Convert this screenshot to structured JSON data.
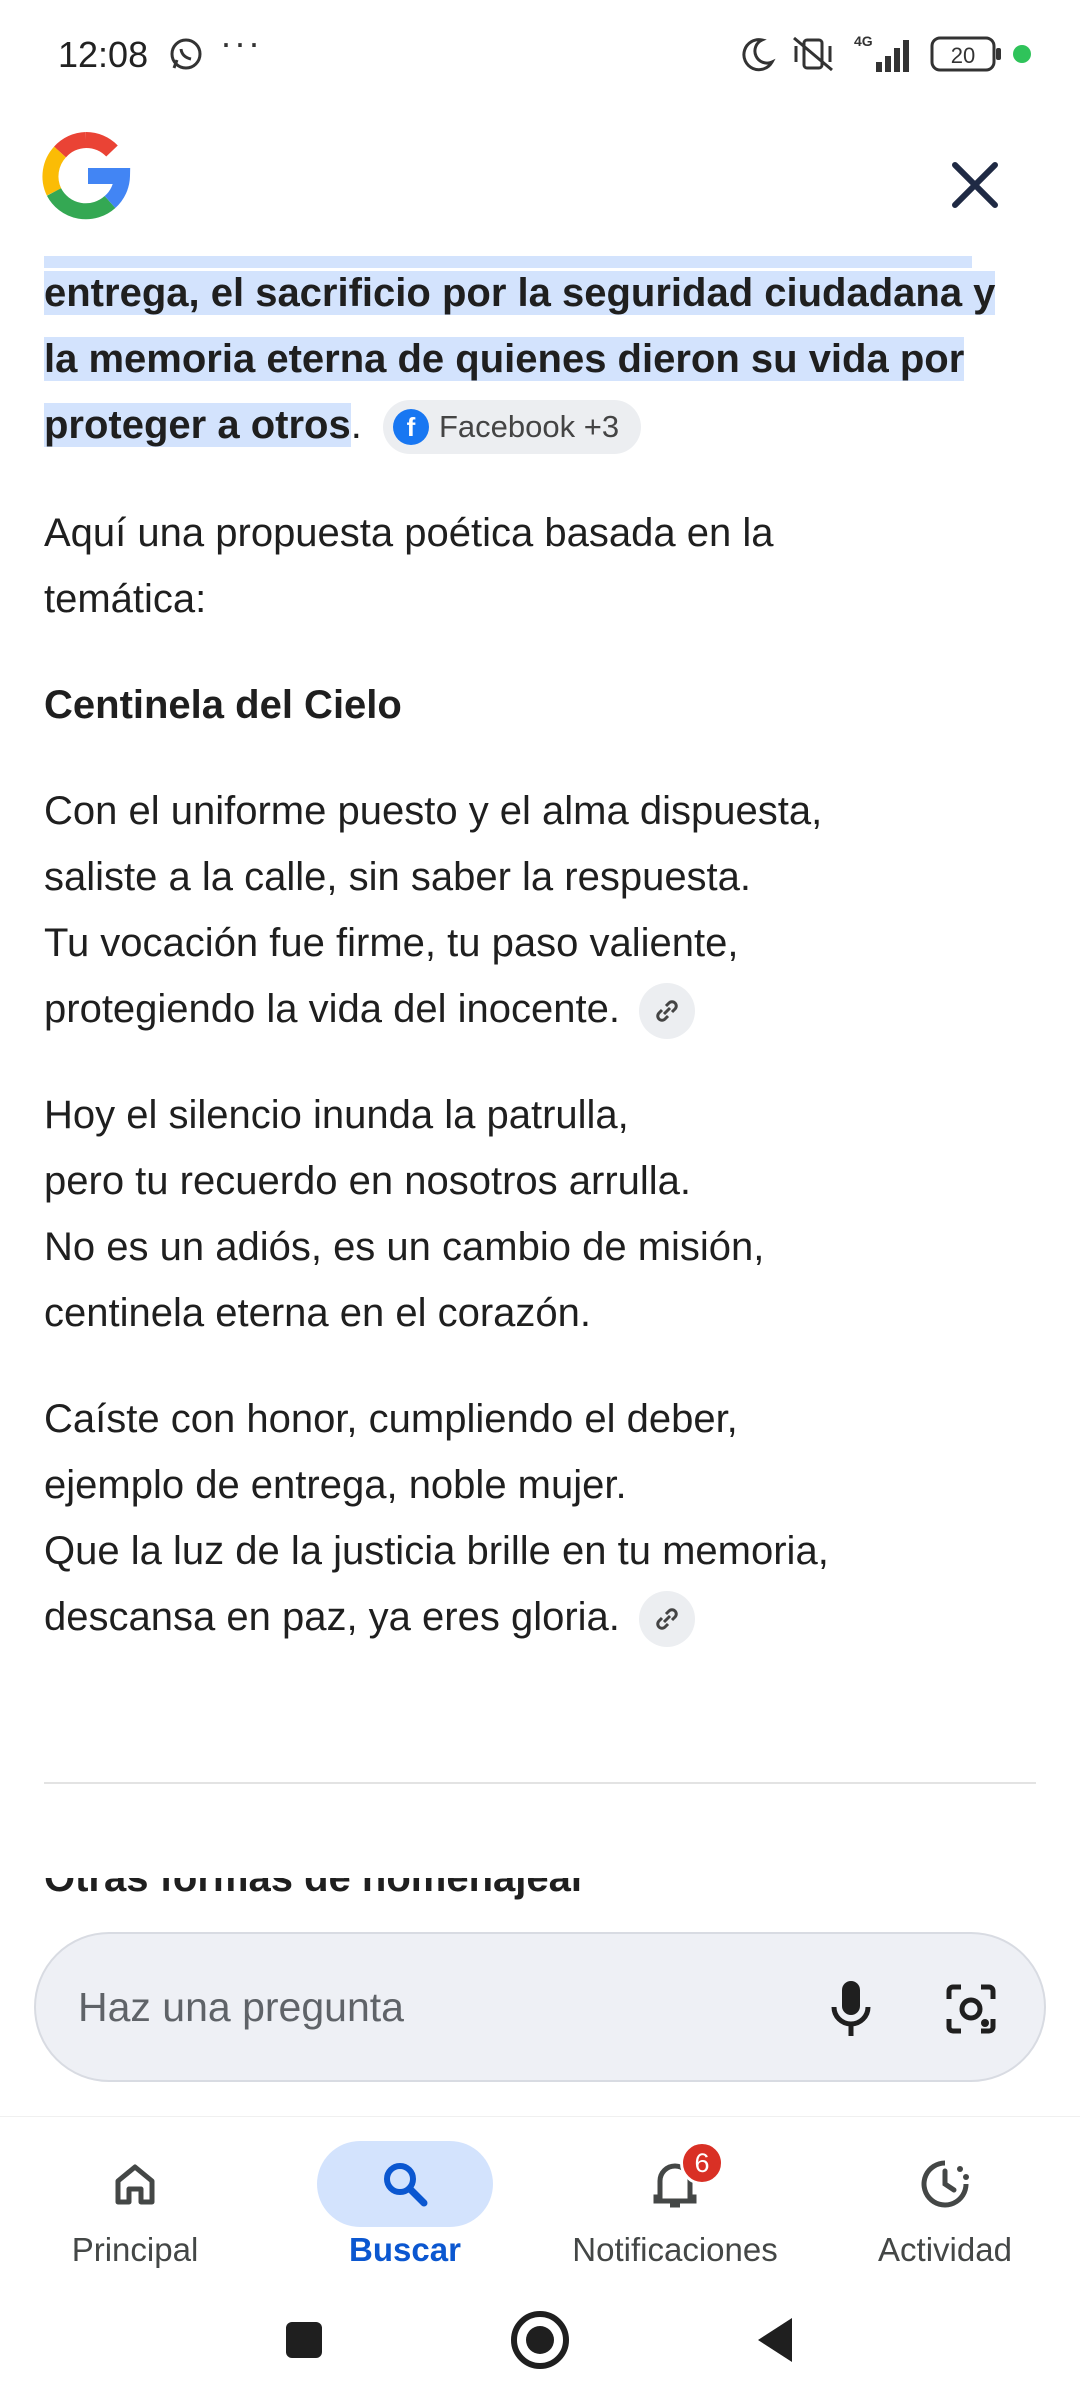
{
  "status_bar": {
    "time": "12:08",
    "battery": "20"
  },
  "header": {
    "logo_name": "google-logo",
    "close_label": "×"
  },
  "answer": {
    "highlight_lines": [
      "entrega, el sacrificio por la seguridad ciudadana y",
      "la memoria eterna de quienes dieron su vida por",
      "proteger a otros"
    ],
    "highlight_end": ".",
    "source_chip": "Facebook +3",
    "intro": "Aquí una propuesta poética basada en la temática:",
    "poem_title": "Centinela del Cielo",
    "stanzas": [
      [
        "Con el uniforme puesto y el alma dispuesta,",
        "saliste a la calle, sin saber la respuesta.",
        "Tu vocación fue firme, tu paso valiente,",
        "protegiendo la vida del inocente."
      ],
      [
        "Hoy el silencio inunda la patrulla,",
        "pero tu recuerdo en nosotros arrulla.",
        "No es un adiós, es un cambio de misión,",
        "centinela eterna en el corazón."
      ],
      [
        "Caíste con honor, cumpliendo el deber,",
        "ejemplo de entrega, noble mujer.",
        "Que la luz de la justicia brille en tu memoria,",
        "descansa en paz, ya eres gloria."
      ]
    ],
    "next_section_cut": "Otras formas de homenajear"
  },
  "ask_bar": {
    "placeholder": "Haz una pregunta"
  },
  "bottom_nav": {
    "items": [
      {
        "label": "Principal",
        "icon": "home-icon"
      },
      {
        "label": "Buscar",
        "icon": "search-icon",
        "active": true
      },
      {
        "label": "Notificaciones",
        "icon": "bell-icon",
        "badge": "6"
      },
      {
        "label": "Actividad",
        "icon": "activity-icon"
      }
    ]
  },
  "colors": {
    "highlight": "#d3e3fd",
    "accent": "#0b57d0",
    "badge": "#d93025"
  }
}
